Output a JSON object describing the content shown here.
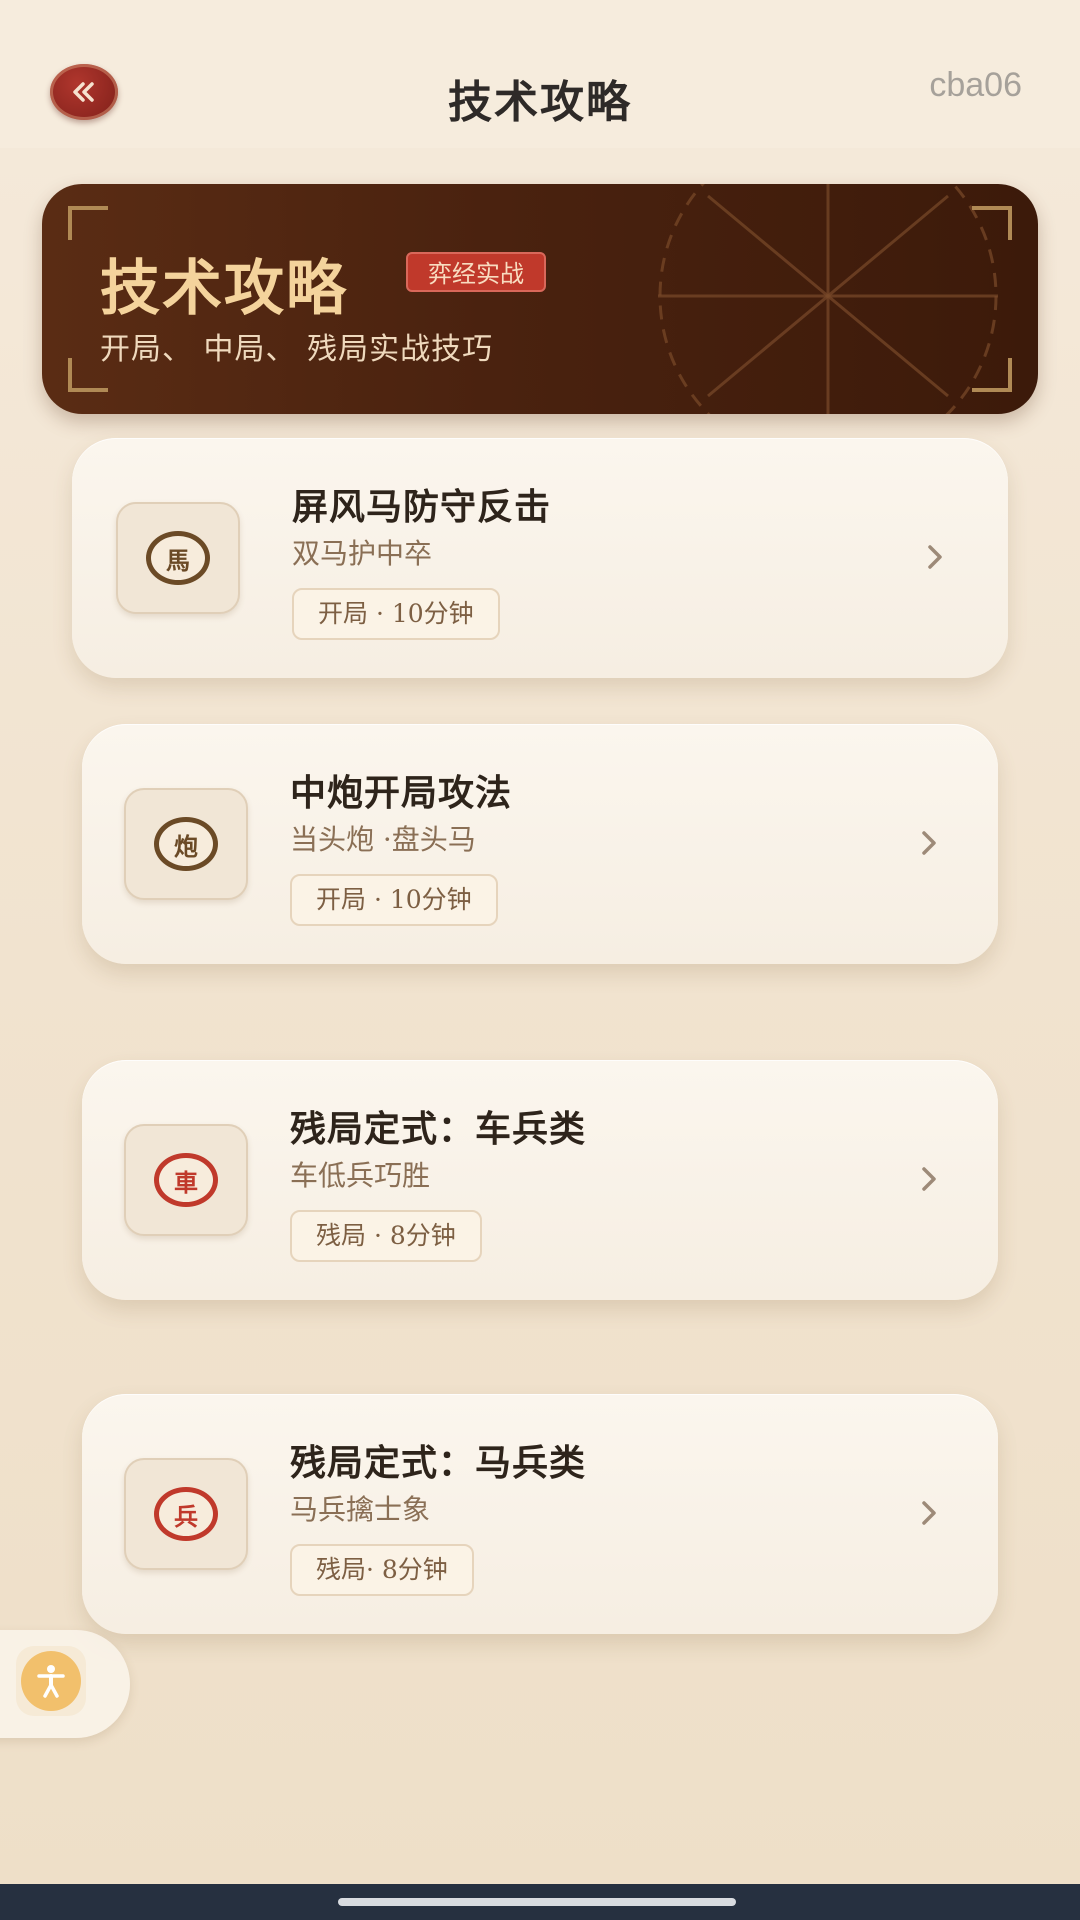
{
  "header": {
    "title": "技术攻略",
    "user_id": "cba06"
  },
  "banner": {
    "title": "技术攻略",
    "badge": "弈经实战",
    "subtitle": "开局、 中局、 残局实战技巧"
  },
  "guides": [
    {
      "piece": "馬",
      "piece_color": "#6b4a26",
      "title": "屏风马防守反击",
      "subtitle": "双马护中卒",
      "tag": "开局 · 10分钟"
    },
    {
      "piece": "炮",
      "piece_color": "#6b4a26",
      "title": "中炮开局攻法",
      "subtitle": "当头炮 ·盘头马",
      "tag": "开局 · 10分钟"
    },
    {
      "piece": "車",
      "piece_color": "#c0392b",
      "title": "残局定式：车兵类",
      "subtitle": "车低兵巧胜",
      "tag": "残局 · 8分钟"
    },
    {
      "piece": "兵",
      "piece_color": "#c0392b",
      "title": "残局定式：马兵类",
      "subtitle": "马兵擒士象",
      "tag": "残局· 8分钟"
    }
  ],
  "icons": {
    "back": "double-chevron-left-icon",
    "chevron": "chevron-right-icon",
    "accessibility": "accessibility-icon"
  },
  "colors": {
    "accent_red": "#c0392b",
    "banner_brown": "#4a220f",
    "gold": "#f4d39c"
  }
}
